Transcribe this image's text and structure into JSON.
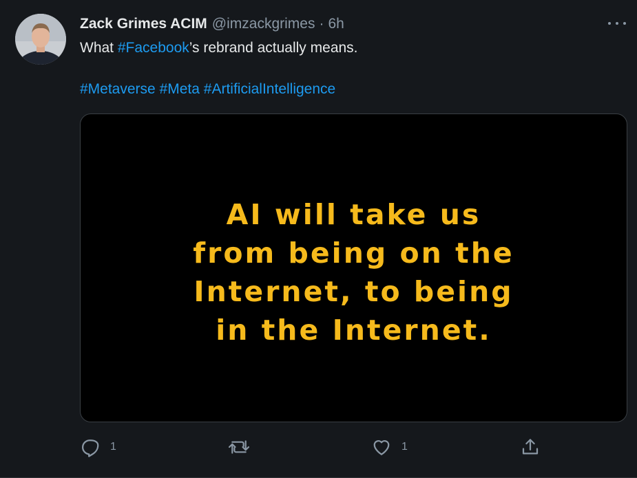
{
  "tweet": {
    "author": {
      "display_name": "Zack Grimes ACIM",
      "handle": "@imzackgrimes",
      "separator": "·",
      "time": "6h"
    },
    "text": {
      "line1_prefix": "What ",
      "line1_hashtag": "#Facebook",
      "line1_suffix": "’s rebrand actually means.",
      "hashtags": [
        "#Metaverse",
        "#Meta",
        "#ArtificialIntelligence"
      ]
    },
    "media": {
      "caption_lines": [
        "AI will take us",
        "from being on the",
        "Internet, to being",
        "in the Internet."
      ],
      "caption_color": "#f6ba1c"
    },
    "actions": {
      "reply_count": "1",
      "like_count": "1"
    }
  },
  "colors": {
    "background": "#15181c",
    "link": "#1d9bf0",
    "secondary_text": "#8b98a5",
    "primary_text": "#e7e9ea"
  },
  "icons": {
    "reply": "reply-icon",
    "retweet": "retweet-icon",
    "like": "heart-icon",
    "share": "share-icon",
    "more": "more-icon"
  }
}
